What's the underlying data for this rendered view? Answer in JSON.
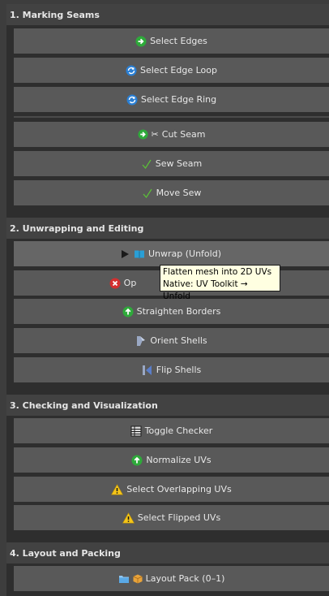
{
  "sections": {
    "seams": {
      "title": "1. Marking Seams",
      "buttons": [
        "Select Edges",
        "Select Edge Loop",
        "Select Edge Ring",
        "Cut Seam",
        "Sew Seam",
        "Move  Sew"
      ]
    },
    "unwrap": {
      "title": "2. Unwrapping and Editing",
      "buttons": [
        "Unwrap (Unfold)",
        "Op",
        "Straighten Borders",
        "Orient Shells",
        "Flip Shells"
      ]
    },
    "checking": {
      "title": "3. Checking and Visualization",
      "buttons": [
        "Toggle Checker",
        "Normalize UVs",
        "Select Overlapping UVs",
        "Select Flipped UVs"
      ]
    },
    "layout": {
      "title": "4. Layout and Packing",
      "buttons": [
        "Layout  Pack (0–1)"
      ]
    }
  },
  "tooltip": {
    "line1": "Flatten mesh into 2D UVs",
    "line2": "Native: UV Toolkit → Unfold"
  },
  "colors": {
    "panel_bg": "#2e2e2e",
    "header_bg": "#424242",
    "button_bg": "#595959",
    "tooltip_bg": "#ffffe1",
    "arrow_green": "#2eaa3a",
    "loop_blue": "#2a7fd4",
    "error_red": "#d32f2f",
    "warning_yellow": "#f5c518"
  }
}
